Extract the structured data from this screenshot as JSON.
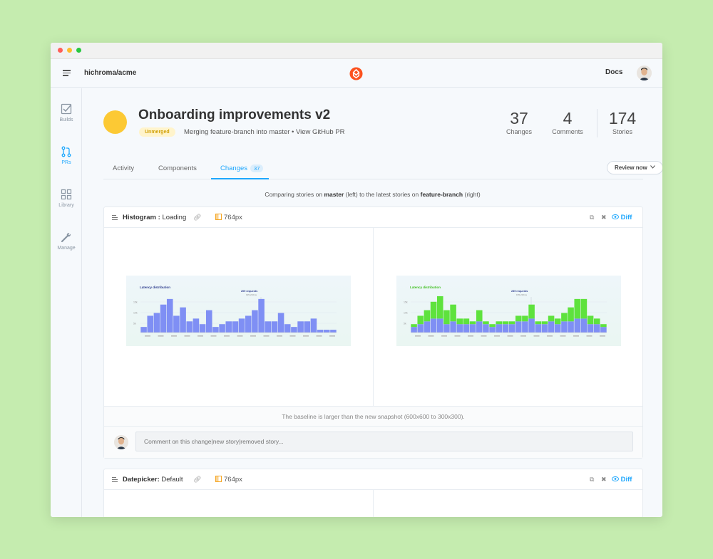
{
  "window": {
    "traffic_lights": [
      "#ff5f57",
      "#febc2e",
      "#28c840"
    ]
  },
  "topnav": {
    "repo": "hichroma/acme",
    "docs_label": "Docs",
    "logo_icon": "chromatic-logo-icon",
    "brand_color": "#fc521f"
  },
  "sidebar": {
    "items": [
      {
        "label": "Builds",
        "icon": "checkbox-icon",
        "active": false
      },
      {
        "label": "PRs",
        "icon": "pull-request-icon",
        "active": true
      },
      {
        "label": "Library",
        "icon": "grid-icon",
        "active": false
      },
      {
        "label": "Manage",
        "icon": "wrench-icon",
        "active": false
      }
    ]
  },
  "pr": {
    "title": "Onboarding improvements v2",
    "status_badge": "Unmerged",
    "subtitle_prefix": "Merging feature-branch into master • ",
    "view_link": "View GitHub PR",
    "status_color": "#fcc934"
  },
  "stats": [
    {
      "value": "37",
      "label": "Changes"
    },
    {
      "value": "4",
      "label": "Comments"
    },
    {
      "value": "174",
      "label": "Stories"
    }
  ],
  "tabs": [
    {
      "label": "Activity",
      "active": false
    },
    {
      "label": "Components",
      "active": false
    },
    {
      "label": "Changes",
      "active": true,
      "count": "37"
    }
  ],
  "review_button": "Review now",
  "compare": {
    "prefix": "Comparing stories on ",
    "base": "master",
    "mid": " (left) to the latest stories on ",
    "head": "feature-branch",
    "suffix": " (right)"
  },
  "stories": [
    {
      "component": "Histogram",
      "separator": ":",
      "story": "Loading",
      "viewport": "764px",
      "diff_label": "Diff",
      "note": "The baseline is larger than the new snapshot (600x600 to 300x300).",
      "comment_placeholder": "Comment on this change|new story|removed story..."
    },
    {
      "component": "Datepicker",
      "separator": ":",
      "story": "Default",
      "viewport": "764px",
      "diff_label": "Diff"
    }
  ],
  "chart_data": [
    {
      "type": "bar",
      "title": "Latency distribution",
      "annotation": "209 requests",
      "annotation_sub": "195-210ms",
      "series_color": "#7f8ff4",
      "values": [
        2,
        6,
        7,
        10,
        12,
        6,
        9,
        4,
        5,
        3,
        8,
        2,
        3,
        4,
        4,
        5,
        6,
        8,
        12,
        4,
        4,
        7,
        3,
        2,
        4,
        4,
        5,
        1,
        1,
        1
      ]
    },
    {
      "type": "bar",
      "title": "Latency distribution",
      "annotation": "239 requests",
      "annotation_sub": "195-210ms",
      "series": [
        {
          "name": "baseline",
          "color": "#7f8ff4",
          "values": [
            2,
            3,
            4,
            5,
            5,
            3,
            4,
            3,
            3,
            3,
            4,
            3,
            2,
            3,
            3,
            3,
            4,
            4,
            5,
            3,
            3,
            4,
            3,
            4,
            4,
            5,
            5,
            3,
            3,
            2
          ]
        },
        {
          "name": "change",
          "color": "#5ee23d",
          "values": [
            1,
            3,
            4,
            6,
            8,
            5,
            6,
            2,
            2,
            1,
            4,
            1,
            1,
            1,
            1,
            1,
            2,
            2,
            5,
            1,
            1,
            2,
            2,
            3,
            5,
            7,
            7,
            3,
            2,
            1
          ]
        }
      ]
    }
  ]
}
